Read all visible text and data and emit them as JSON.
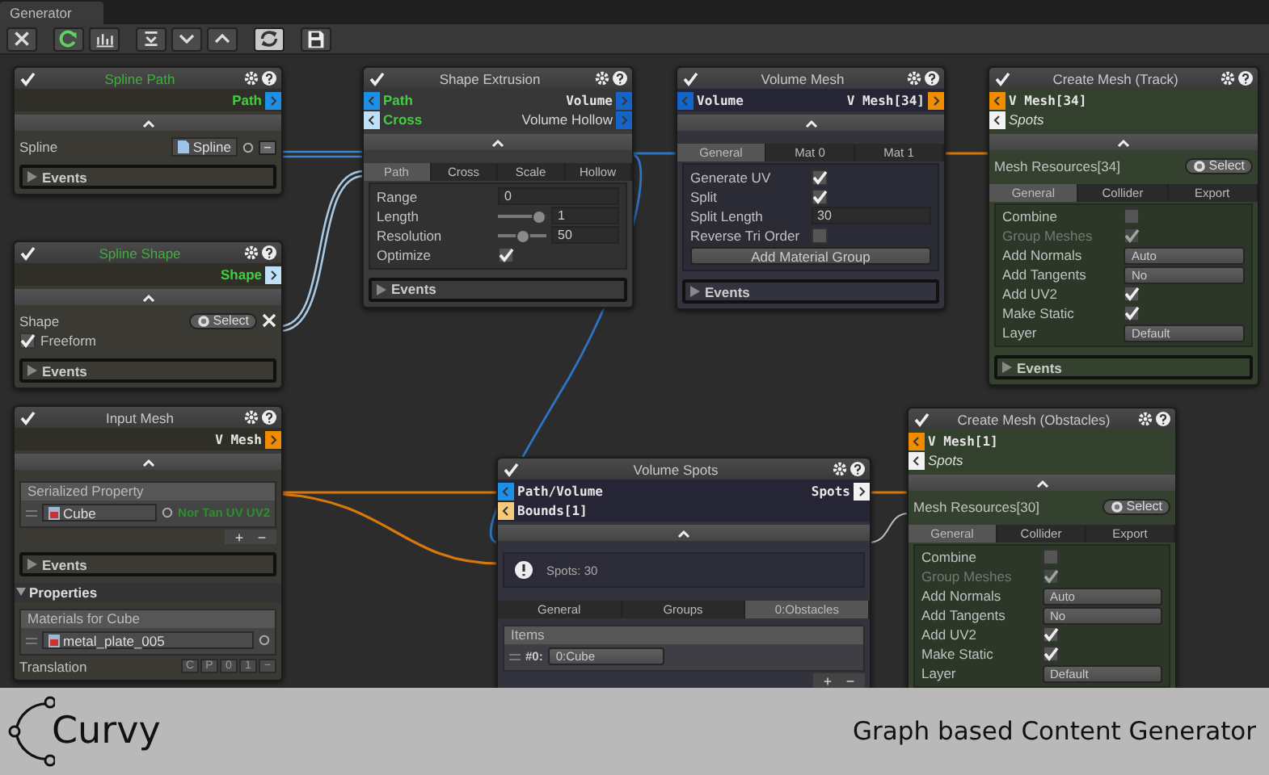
{
  "window": {
    "tab": "Generator"
  },
  "toolbar": [
    {
      "kind": "clear",
      "on": false
    },
    {
      "kind": "refresh",
      "on": false
    },
    {
      "kind": "stats",
      "on": false
    },
    {
      "kind": "collapse-all",
      "on": false
    },
    {
      "kind": "collapse",
      "on": false
    },
    {
      "kind": "expand",
      "on": false
    },
    {
      "kind": "sync",
      "on": true
    },
    {
      "kind": "save",
      "on": false
    }
  ],
  "nodes": [
    {
      "title": "Spline Path",
      "kind": "input",
      "color": "#3fae3f",
      "enabled": true,
      "outputs": [
        {
          "label": "Path",
          "kind": "path",
          "optional": false,
          "color": "#1e8fe6"
        }
      ],
      "rows": [
        {
          "kind": "object",
          "label": "Spline",
          "value": "Spline",
          "remove": "−"
        },
        {
          "kind": "events",
          "label": "Events"
        }
      ]
    },
    {
      "title": "Spline Shape",
      "kind": "input",
      "color": "#3fae3f",
      "enabled": true,
      "outputs": [
        {
          "label": "Shape",
          "kind": "shape",
          "optional": false,
          "color": "#bfe0f7"
        }
      ],
      "rows": [
        {
          "kind": "select",
          "label": "Shape",
          "button": "Select",
          "clear": true
        },
        {
          "kind": "toggle",
          "label": "Freeform",
          "checked": true
        },
        {
          "kind": "events",
          "label": "Events"
        }
      ]
    },
    {
      "title": "Input Mesh",
      "kind": "input",
      "color": "#c8c8c8",
      "enabled": true,
      "outputs": [
        {
          "label": "V Mesh",
          "kind": "vmesh",
          "optional": false,
          "color": "#f08c00"
        }
      ],
      "rows": [
        {
          "kind": "list",
          "title": "Serialized Property",
          "items": [
            {
              "value": "Cube",
              "note": "Nor Tan UV UV2"
            }
          ],
          "add": "+",
          "remove": "−"
        },
        {
          "kind": "events",
          "label": "Events"
        },
        {
          "kind": "foldout",
          "label": "Properties",
          "expanded": true
        },
        {
          "kind": "list",
          "title": "Materials for Cube",
          "items": [
            {
              "value": "metal_plate_005"
            }
          ]
        },
        {
          "kind": "transform",
          "label": "Translation",
          "buttons": [
            "C",
            "P",
            "0",
            "1",
            "−"
          ]
        }
      ]
    },
    {
      "title": "Shape Extrusion",
      "kind": "modifier",
      "color": "#c8c8c8",
      "enabled": true,
      "inputs": [
        {
          "label": "Path",
          "kind": "path",
          "optional": false,
          "color": "#1e8fe6"
        },
        {
          "label": "Cross",
          "kind": "shape",
          "optional": false,
          "color": "#bfe0f7"
        }
      ],
      "outputs": [
        {
          "label": "Volume",
          "kind": "volume",
          "optional": false,
          "color": "#1565c8"
        },
        {
          "label": "Volume Hollow",
          "kind": "volume",
          "optional": true,
          "color": "#1565c8"
        }
      ],
      "rows": [
        {
          "kind": "tabs",
          "tabs": [
            {
              "label": "Path",
              "selected": true
            },
            {
              "label": "Cross",
              "selected": false
            },
            {
              "label": "Scale",
              "selected": false
            },
            {
              "label": "Hollow",
              "selected": false
            }
          ]
        },
        {
          "kind": "group",
          "rows": [
            {
              "kind": "field",
              "label": "Range",
              "value": "0"
            },
            {
              "kind": "slider",
              "label": "Length",
              "level": 0.95,
              "value": "1"
            },
            {
              "kind": "slider",
              "label": "Resolution",
              "level": 0.5,
              "value": "50"
            },
            {
              "kind": "check",
              "label": "Optimize",
              "checked": true
            }
          ]
        },
        {
          "kind": "events",
          "label": "Events"
        }
      ]
    },
    {
      "title": "Volume Mesh",
      "kind": "build",
      "color": "#c8c8c8",
      "enabled": true,
      "inputs": [
        {
          "label": "Volume",
          "kind": "volume",
          "optional": false,
          "color": "#1565c8"
        }
      ],
      "outputs": [
        {
          "label": "V Mesh[34]",
          "kind": "vmesh",
          "optional": false,
          "color": "#f08c00"
        }
      ],
      "rows": [
        {
          "kind": "tabs",
          "tabs": [
            {
              "label": "General",
              "selected": true
            },
            {
              "label": "Mat 0",
              "selected": false
            },
            {
              "label": "Mat 1",
              "selected": false
            }
          ]
        },
        {
          "kind": "group",
          "rows": [
            {
              "kind": "check",
              "label": "Generate UV",
              "checked": true
            },
            {
              "kind": "check",
              "label": "Split",
              "checked": true
            },
            {
              "kind": "field",
              "label": "Split Length",
              "value": "30"
            },
            {
              "kind": "check",
              "label": "Reverse Tri Order",
              "checked": false
            },
            {
              "kind": "button",
              "label": "Add Material Group"
            }
          ]
        },
        {
          "kind": "events",
          "label": "Events"
        }
      ]
    },
    {
      "title": "Create Mesh (Track)",
      "kind": "output",
      "color": "#c8c8c8",
      "enabled": true,
      "inputs": [
        {
          "label": "V Mesh[34]",
          "kind": "vmesh",
          "optional": false,
          "color": "#f08c00"
        },
        {
          "label": "Spots",
          "kind": "spots",
          "optional": true,
          "color": "#f2f2f2"
        }
      ],
      "rows": [
        {
          "kind": "select",
          "label": "Mesh Resources[34]",
          "button": "Select",
          "clear": false
        },
        {
          "kind": "tabs",
          "tabs": [
            {
              "label": "General",
              "selected": true
            },
            {
              "label": "Collider",
              "selected": false
            },
            {
              "label": "Export",
              "selected": false
            }
          ]
        },
        {
          "kind": "group",
          "rows": [
            {
              "kind": "check",
              "label": "Combine",
              "checked": false
            },
            {
              "kind": "check",
              "label": "Group Meshes",
              "checked": true,
              "disabled": true
            },
            {
              "kind": "dropdown",
              "label": "Add Normals",
              "value": "Auto"
            },
            {
              "kind": "dropdown",
              "label": "Add Tangents",
              "value": "No"
            },
            {
              "kind": "check",
              "label": "Add UV2",
              "checked": true
            },
            {
              "kind": "check",
              "label": "Make Static",
              "checked": true
            },
            {
              "kind": "dropdown",
              "label": "Layer",
              "value": "Default"
            }
          ]
        },
        {
          "kind": "events",
          "label": "Events"
        }
      ]
    },
    {
      "title": "Volume Spots",
      "kind": "build",
      "color": "#c8c8c8",
      "enabled": true,
      "inputs": [
        {
          "label": "Path/Volume",
          "kind": "volume",
          "optional": false,
          "color": "#1e8fe6"
        },
        {
          "label": "Bounds[1]",
          "kind": "bounds",
          "optional": false,
          "color": "#f5c97a"
        }
      ],
      "outputs": [
        {
          "label": "Spots",
          "kind": "spots",
          "optional": false,
          "color": "#f2f2f2"
        }
      ],
      "rows": [
        {
          "kind": "info",
          "text": "Spots: 30"
        },
        {
          "kind": "tabs",
          "tabs": [
            {
              "label": "General",
              "selected": false
            },
            {
              "label": "Groups",
              "selected": false
            },
            {
              "label": "0:Obstacles",
              "selected": true
            }
          ]
        },
        {
          "kind": "list",
          "title": "Items",
          "items": [
            {
              "index": "#0:",
              "value": "0:Cube"
            }
          ],
          "add": "+",
          "remove": "−"
        }
      ]
    },
    {
      "title": "Create Mesh (Obstacles)",
      "kind": "output",
      "color": "#c8c8c8",
      "enabled": true,
      "inputs": [
        {
          "label": "V Mesh[1]",
          "kind": "vmesh",
          "optional": false,
          "color": "#f08c00"
        },
        {
          "label": "Spots",
          "kind": "spots",
          "optional": true,
          "color": "#f2f2f2"
        }
      ],
      "rows": [
        {
          "kind": "select",
          "label": "Mesh Resources[30]",
          "button": "Select",
          "clear": false
        },
        {
          "kind": "tabs",
          "tabs": [
            {
              "label": "General",
              "selected": true
            },
            {
              "label": "Collider",
              "selected": false
            },
            {
              "label": "Export",
              "selected": false
            }
          ]
        },
        {
          "kind": "group",
          "rows": [
            {
              "kind": "check",
              "label": "Combine",
              "checked": false
            },
            {
              "kind": "check",
              "label": "Group Meshes",
              "checked": true,
              "disabled": true
            },
            {
              "kind": "dropdown",
              "label": "Add Normals",
              "value": "Auto"
            },
            {
              "kind": "dropdown",
              "label": "Add Tangents",
              "value": "No"
            },
            {
              "kind": "check",
              "label": "Add UV2",
              "checked": true
            },
            {
              "kind": "check",
              "label": "Make Static",
              "checked": true
            },
            {
              "kind": "dropdown",
              "label": "Layer",
              "value": "Default"
            }
          ]
        }
      ]
    }
  ],
  "banner": {
    "logo": "Curvy",
    "caption": "Graph based Content Generator"
  }
}
